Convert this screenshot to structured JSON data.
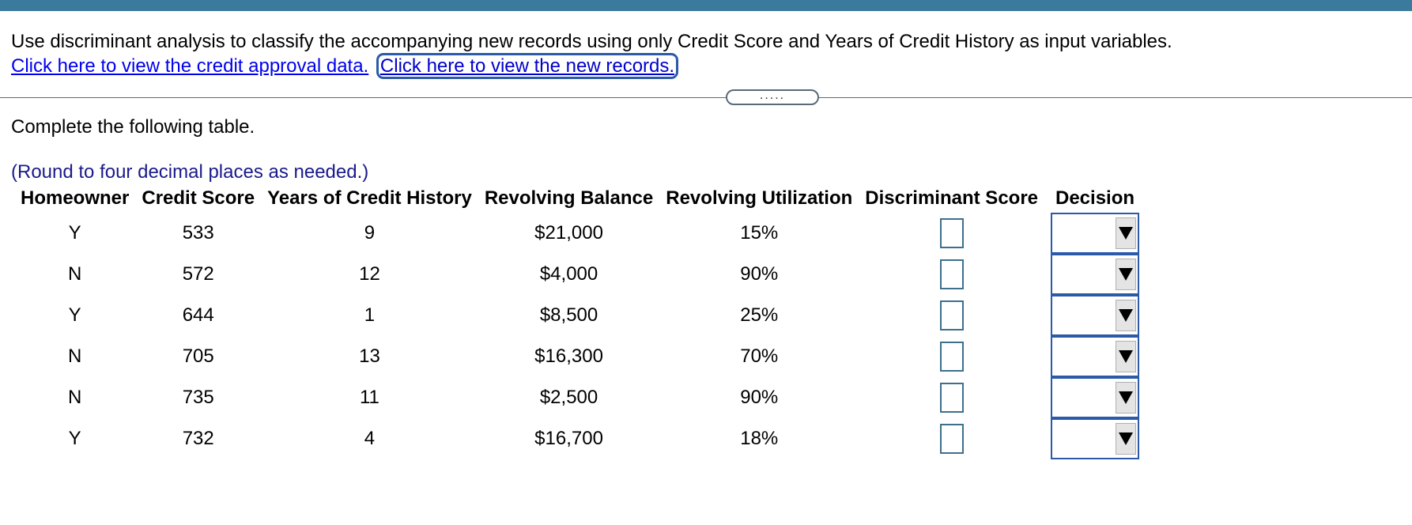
{
  "question": {
    "text": "Use discriminant analysis to classify the accompanying new records using only Credit Score and Years of Credit History as input variables.",
    "link_data": "Click here to view the credit approval data.",
    "link_records": "Click here to view the new records."
  },
  "divider": {
    "handle_label": "....."
  },
  "instruction": "Complete the following table.",
  "note": "(Round to four decimal places as needed.)",
  "table": {
    "headers": [
      "Homeowner",
      "Credit Score",
      "Years of Credit History",
      "Revolving Balance",
      "Revolving Utilization",
      "Discriminant Score",
      "Decision"
    ],
    "rows": [
      {
        "homeowner": "Y",
        "credit_score": "533",
        "years": "9",
        "balance": "$21,000",
        "utilization": "15%",
        "discriminant_score": "",
        "decision": ""
      },
      {
        "homeowner": "N",
        "credit_score": "572",
        "years": "12",
        "balance": "$4,000",
        "utilization": "90%",
        "discriminant_score": "",
        "decision": ""
      },
      {
        "homeowner": "Y",
        "credit_score": "644",
        "years": "1",
        "balance": "$8,500",
        "utilization": "25%",
        "discriminant_score": "",
        "decision": ""
      },
      {
        "homeowner": "N",
        "credit_score": "705",
        "years": "13",
        "balance": "$16,300",
        "utilization": "70%",
        "discriminant_score": "",
        "decision": ""
      },
      {
        "homeowner": "N",
        "credit_score": "735",
        "years": "11",
        "balance": "$2,500",
        "utilization": "90%",
        "discriminant_score": "",
        "decision": ""
      },
      {
        "homeowner": "Y",
        "credit_score": "732",
        "years": "4",
        "balance": "$16,700",
        "utilization": "18%",
        "discriminant_score": "",
        "decision": ""
      }
    ]
  },
  "colors": {
    "top_bar": "#3b7a9c",
    "link": "#0000ee",
    "note": "#1a1a8c",
    "input_border": "#3d6f8f",
    "select_border": "#2a5aa8"
  },
  "icons": {
    "dropdown": "triangle-down-icon"
  }
}
